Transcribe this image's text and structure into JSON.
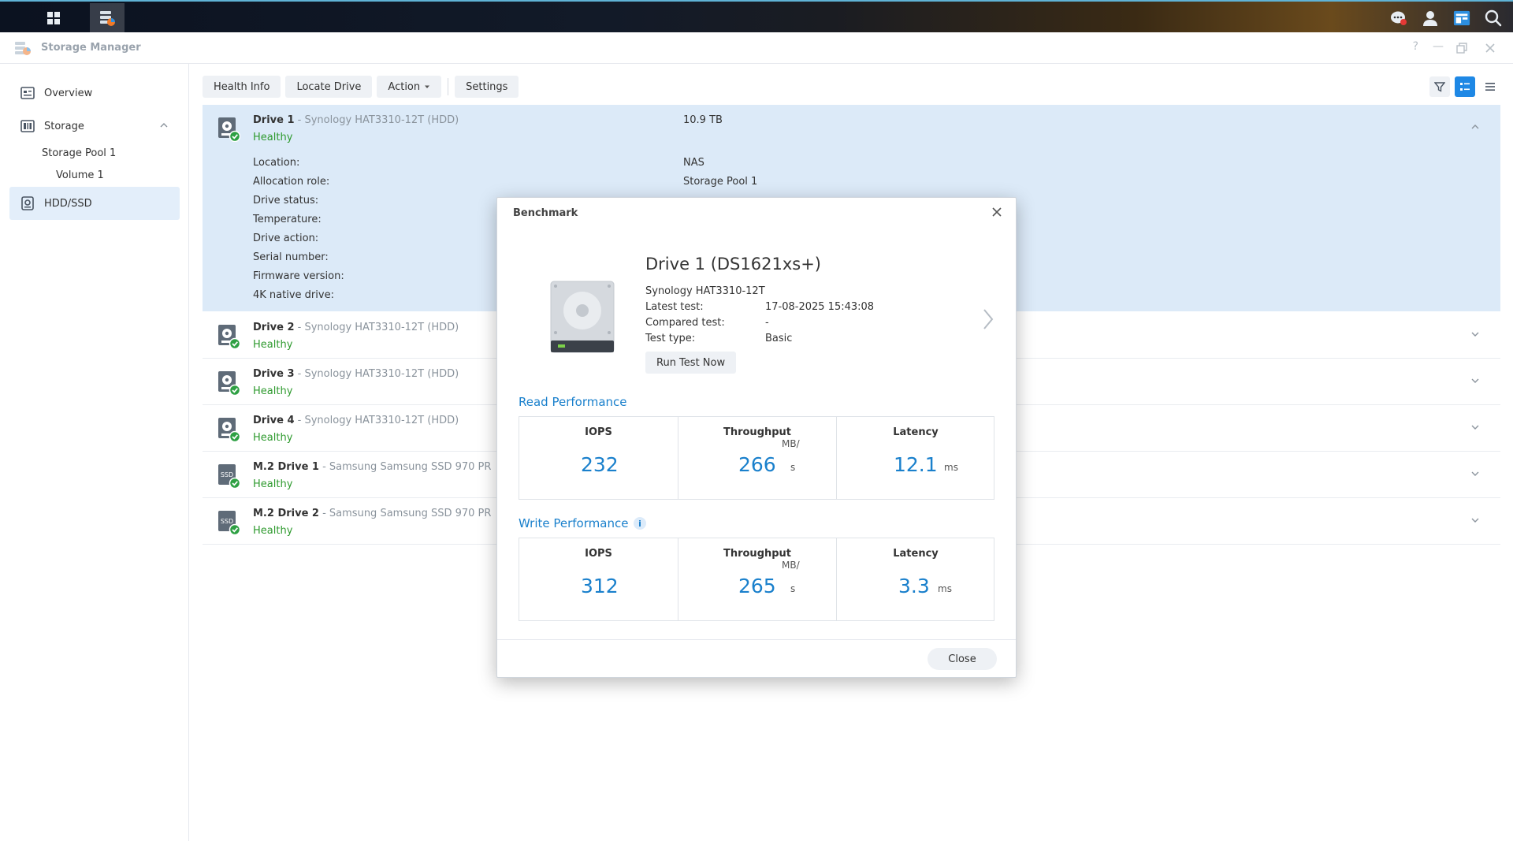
{
  "window": {
    "title": "Storage Manager"
  },
  "sidebar": {
    "overview": "Overview",
    "storage": "Storage",
    "pool": "Storage Pool 1",
    "volume": "Volume 1",
    "hdd": "HDD/SSD"
  },
  "toolbar": {
    "health_info": "Health Info",
    "locate_drive": "Locate Drive",
    "action": "Action",
    "settings": "Settings"
  },
  "drives": [
    {
      "name": "Drive 1",
      "model": " - Synology HAT3310-12T (HDD)",
      "status": "Healthy",
      "capacity": "10.9 TB",
      "type": "hdd"
    },
    {
      "name": "Drive 2",
      "model": " - Synology HAT3310-12T (HDD)",
      "status": "Healthy",
      "type": "hdd"
    },
    {
      "name": "Drive 3",
      "model": " - Synology HAT3310-12T (HDD)",
      "status": "Healthy",
      "type": "hdd"
    },
    {
      "name": "Drive 4",
      "model": " - Synology HAT3310-12T (HDD)",
      "status": "Healthy",
      "type": "hdd"
    },
    {
      "name": "M.2 Drive 1",
      "model": " - Samsung Samsung SSD 970 PR",
      "status": "Healthy",
      "type": "ssd"
    },
    {
      "name": "M.2 Drive 2",
      "model": " - Samsung Samsung SSD 970 PR",
      "status": "Healthy",
      "type": "ssd"
    }
  ],
  "drive_details": {
    "labels": [
      "Location:",
      "Allocation role:",
      "Drive status:",
      "Temperature:",
      "Drive action:",
      "Serial number:",
      "Firmware version:",
      "4K native drive:"
    ],
    "location": "NAS",
    "allocation_role": "Storage Pool 1"
  },
  "benchmark": {
    "title": "Benchmark",
    "drive_title": "Drive 1 (DS1621xs+)",
    "model": "Synology HAT3310-12T",
    "latest_test_label": "Latest test:",
    "latest_test": "17-08-2025 15:43:08",
    "compared_test_label": "Compared test:",
    "compared_test": "-",
    "test_type_label": "Test type:",
    "test_type": "Basic",
    "run_button": "Run Test Now",
    "read": {
      "title": "Read Performance",
      "iops_label": "IOPS",
      "iops": "232",
      "throughput_label": "Throughput",
      "throughput": "266",
      "throughput_unit_top": "MB/",
      "throughput_unit_bottom": "s",
      "latency_label": "Latency",
      "latency": "12.1",
      "latency_unit": "ms"
    },
    "write": {
      "title": "Write Performance",
      "iops_label": "IOPS",
      "iops": "312",
      "throughput_label": "Throughput",
      "throughput": "265",
      "throughput_unit_top": "MB/",
      "throughput_unit_bottom": "s",
      "latency_label": "Latency",
      "latency": "3.3",
      "latency_unit": "ms"
    },
    "close_button": "Close",
    "info_glyph": "i"
  },
  "colors": {
    "accent": "#1a80cc",
    "healthy": "#2e9a2e",
    "selected_row": "#dceaf8"
  }
}
